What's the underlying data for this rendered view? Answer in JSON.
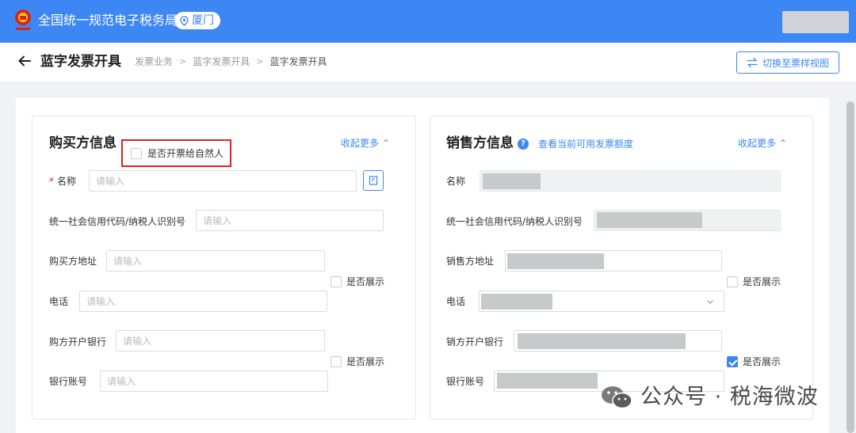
{
  "header": {
    "site_title": "全国统一规范电子税务局",
    "city": "厦门"
  },
  "subheader": {
    "page_title": "蓝字发票开具",
    "breadcrumb": [
      "发票业务",
      "蓝字发票开具",
      "蓝字发票开具"
    ],
    "switch_view_label": "切换至票样视图"
  },
  "buyer": {
    "title": "购买方信息",
    "natural_person_label": "是否开票给自然人",
    "natural_person_checked": false,
    "collapse_label": "收起更多",
    "fields": {
      "name": {
        "label": "名称",
        "required": true,
        "placeholder": "请输入"
      },
      "tax_id": {
        "label": "统一社会信用代码/纳税人识别号",
        "placeholder": "请输入"
      },
      "address": {
        "label": "购买方地址",
        "placeholder": "请输入"
      },
      "phone": {
        "label": "电话",
        "placeholder": "请输入"
      },
      "bank": {
        "label": "购方开户银行",
        "placeholder": "请输入"
      },
      "account": {
        "label": "银行账号",
        "placeholder": "请输入"
      }
    },
    "show_address_phone": {
      "label": "是否展示",
      "checked": false
    },
    "show_bank": {
      "label": "是否展示",
      "checked": false
    }
  },
  "seller": {
    "title": "销售方信息",
    "quota_link": "查看当前可用发票额度",
    "collapse_label": "收起更多",
    "fields": {
      "name": {
        "label": "名称"
      },
      "tax_id": {
        "label": "统一社会信用代码/纳税人识别号"
      },
      "address": {
        "label": "销售方地址"
      },
      "phone": {
        "label": "电话"
      },
      "bank": {
        "label": "销方开户银行"
      },
      "account": {
        "label": "银行账号"
      }
    },
    "show_address_phone": {
      "label": "是否展示",
      "checked": false
    },
    "show_bank": {
      "label": "是否展示",
      "checked": true
    }
  },
  "watermark": {
    "text": "公众号 · 税海微波"
  },
  "colors": {
    "primary": "#3d87f5",
    "highlight_border": "#e02020",
    "required": "#e02020"
  }
}
